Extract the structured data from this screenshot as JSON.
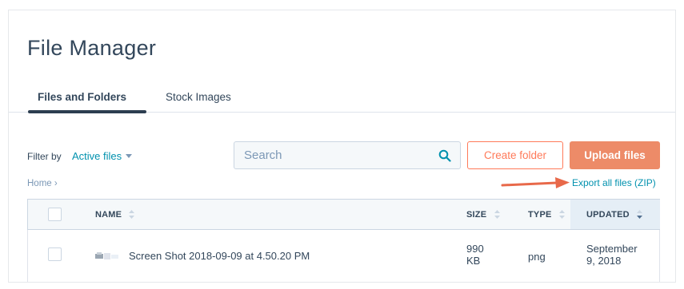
{
  "page": {
    "title": "File Manager"
  },
  "tabs": [
    {
      "label": "Files and Folders",
      "active": true
    },
    {
      "label": "Stock Images",
      "active": false
    }
  ],
  "toolbar": {
    "filter_label": "Filter by",
    "filter_value": "Active files",
    "search_placeholder": "Search",
    "create_folder_label": "Create folder",
    "upload_label": "Upload files"
  },
  "breadcrumb": {
    "home": "Home ›"
  },
  "export_label": "Export all files (ZIP)",
  "table": {
    "columns": {
      "name": "NAME",
      "size": "SIZE",
      "type": "TYPE",
      "updated": "UPDATED"
    },
    "sorted_column": "UPDATED",
    "rows": [
      {
        "name": "Screen Shot 2018-09-09 at 4.50.20 PM",
        "size_line1": "990",
        "size_line2": "KB",
        "type": "png",
        "updated_line1": "September",
        "updated_line2": "9, 2018"
      }
    ]
  },
  "colors": {
    "accent": "#ff7a59",
    "link": "#0091ae",
    "text": "#33475b",
    "arrow": "#e8694a"
  },
  "icons": {
    "search": "search-icon",
    "sort": "sort-icon",
    "caret": "caret-down-icon",
    "arrow": "arrow-right-icon"
  }
}
